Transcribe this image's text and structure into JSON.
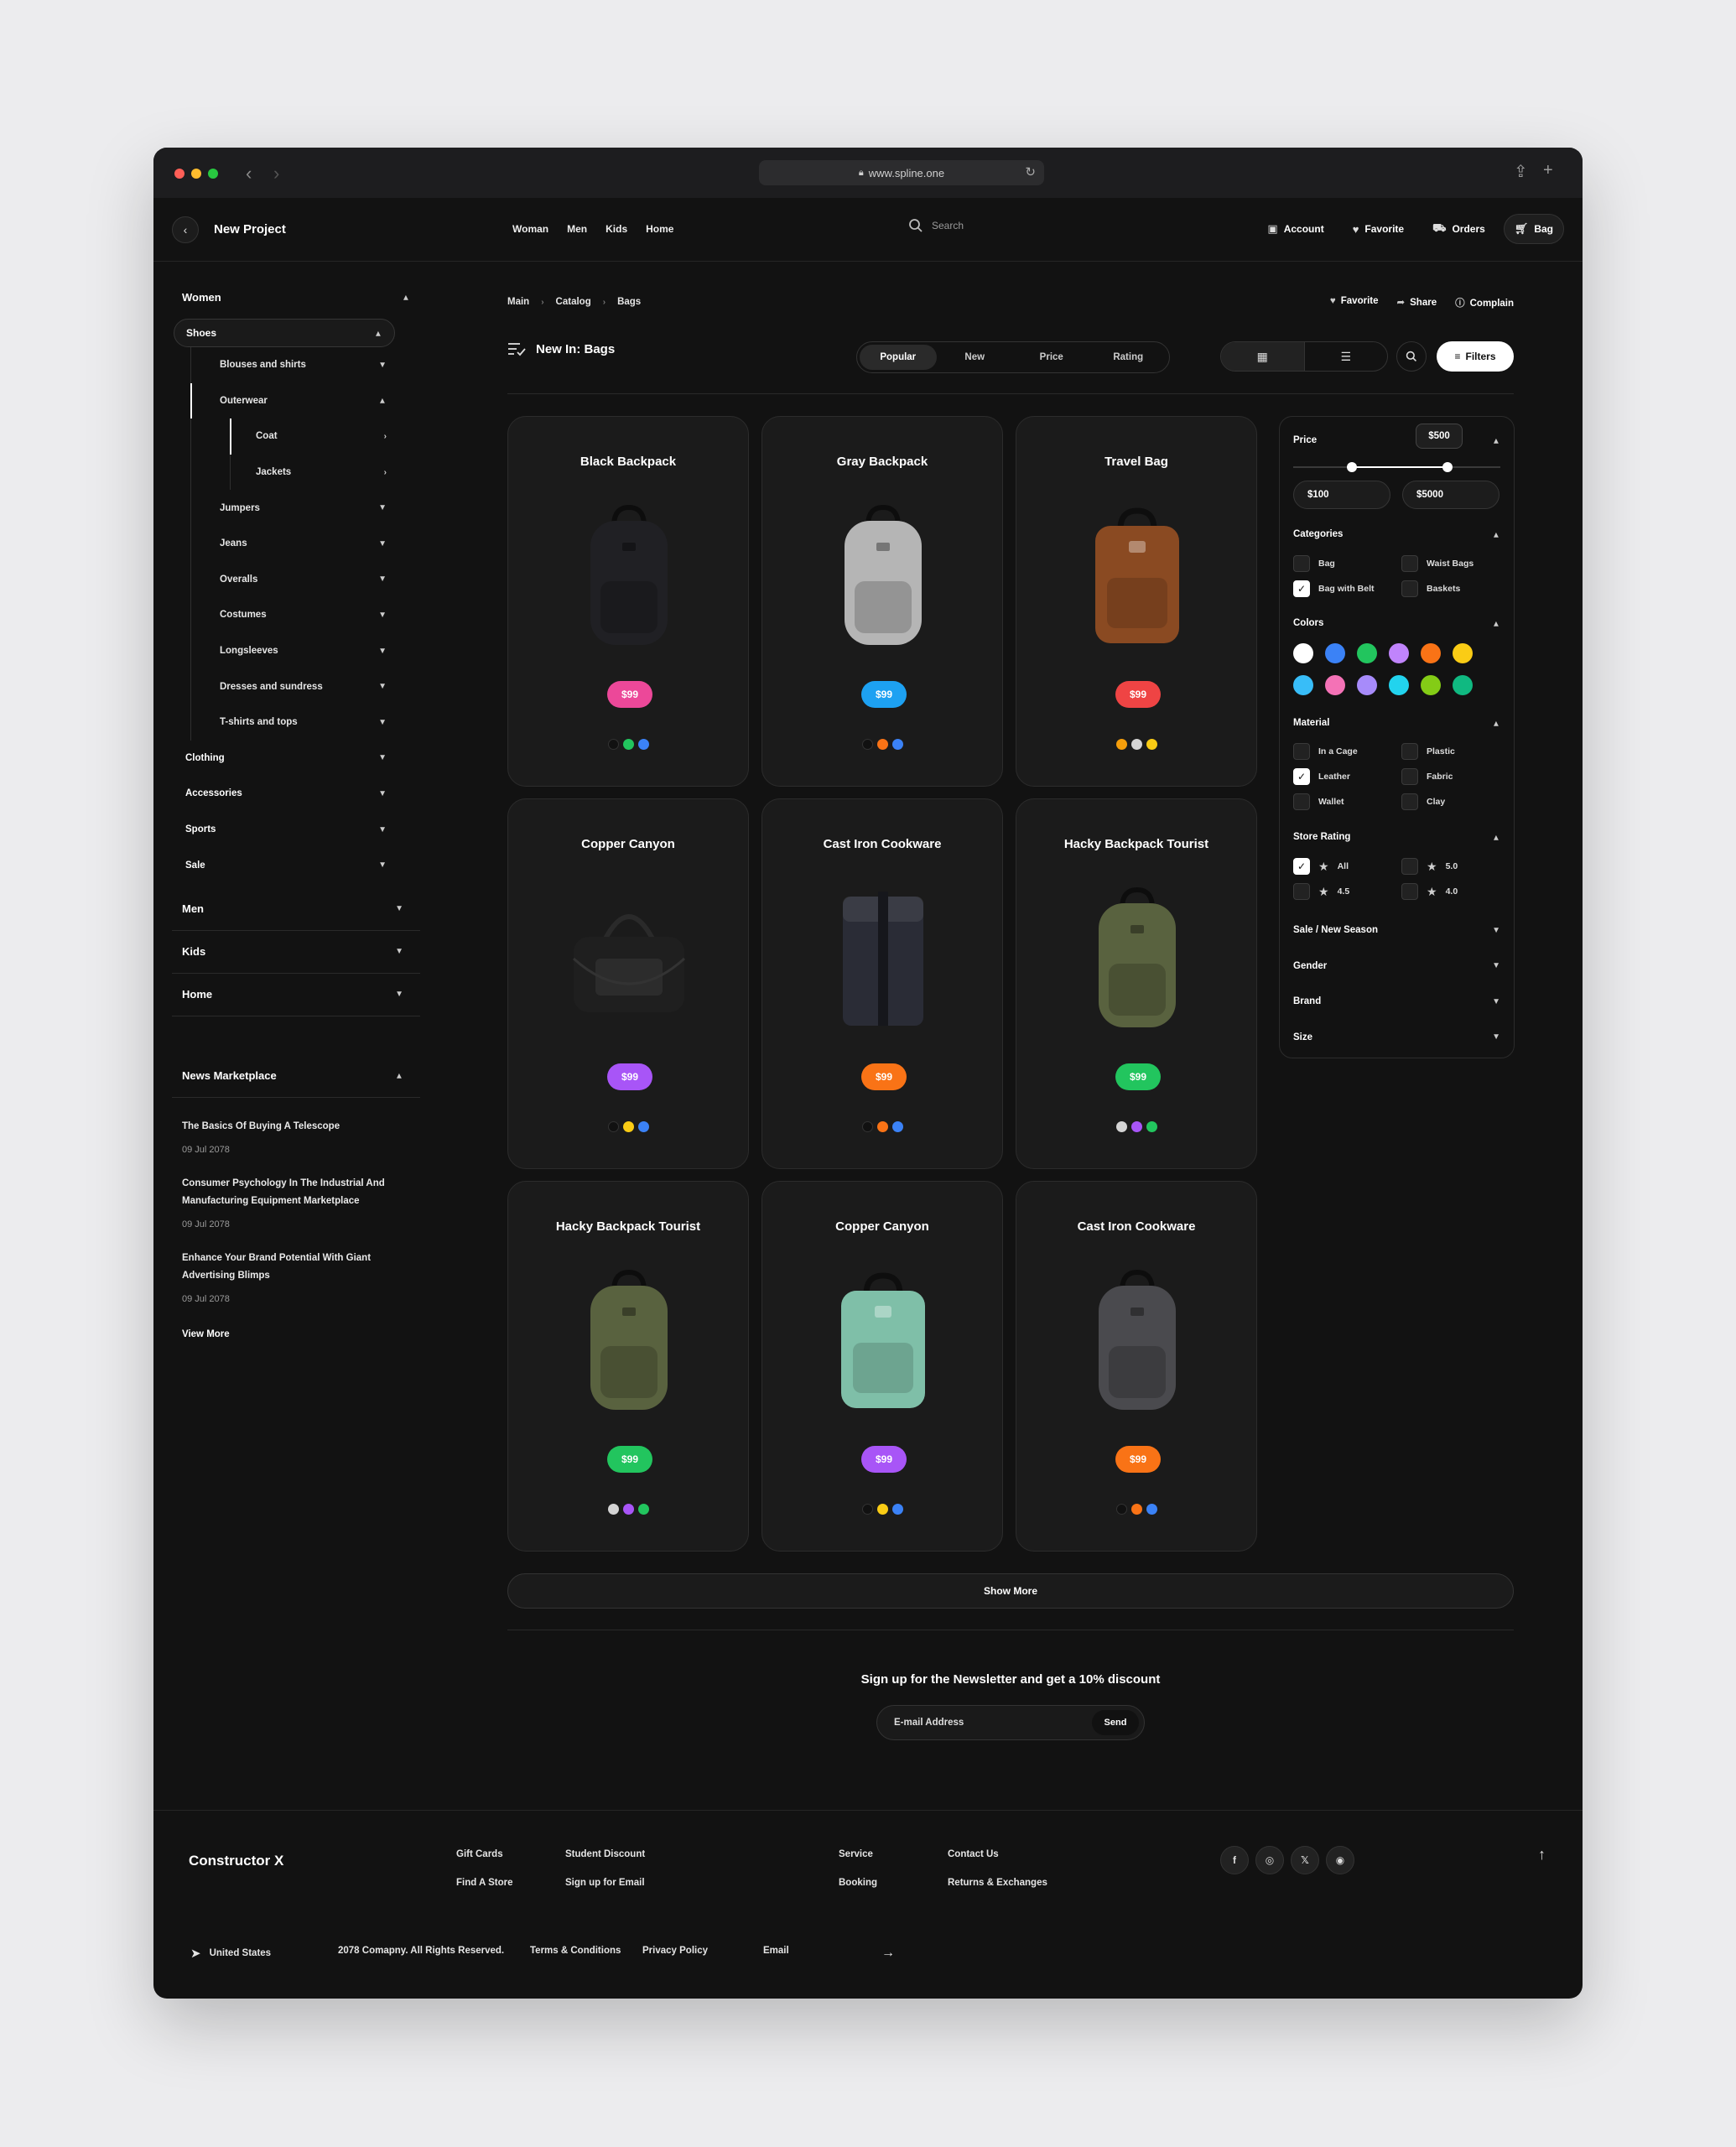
{
  "browser": {
    "url": "www.spline.one"
  },
  "header": {
    "project_title": "New Project",
    "nav": [
      "Woman",
      "Men",
      "Kids",
      "Home"
    ],
    "search_placeholder": "Search",
    "actions": {
      "account": "Account",
      "favorite": "Favorite",
      "orders": "Orders",
      "bag": "Bag"
    }
  },
  "sidebar": {
    "women": "Women",
    "shoes": "Shoes",
    "shoes_items": [
      "Blouses and shirts",
      "Outerwear"
    ],
    "outerwear_items": [
      "Coat",
      "Jackets"
    ],
    "shoes_items_after": [
      "Jumpers",
      "Jeans",
      "Overalls",
      "Costumes",
      "Longsleeves",
      "Dresses and sundress",
      "T-shirts and tops"
    ],
    "women_items": [
      "Clothing",
      "Accessories",
      "Sports",
      "Sale"
    ],
    "main_sections": [
      "Men",
      "Kids",
      "Home"
    ],
    "news": {
      "title": "News Marketplace",
      "items": [
        {
          "title": "The Basics Of Buying A Telescope",
          "date": "09 Jul 2078"
        },
        {
          "title": "Consumer Psychology In The Industrial And Manufacturing Equipment Marketplace",
          "date": "09 Jul 2078"
        },
        {
          "title": "Enhance Your Brand Potential With Giant Advertising Blimps",
          "date": "09 Jul 2078"
        }
      ],
      "view_more": "View More"
    }
  },
  "breadcrumb": [
    "Main",
    "Catalog",
    "Bags"
  ],
  "page_actions": {
    "favorite": "Favorite",
    "share": "Share",
    "complain": "Complain"
  },
  "section_title": "New In: Bags",
  "sort_tabs": [
    "Popular",
    "New",
    "Price",
    "Rating"
  ],
  "filters_label": "Filters",
  "products": [
    {
      "name": "Black Backpack",
      "price": "$99",
      "price_color": "#ec4899",
      "bag_color": "#202024",
      "bag_type": "backpack",
      "swatches": [
        "#111111",
        "#22c55e",
        "#3b82f6"
      ]
    },
    {
      "name": "Gray Backpack",
      "price": "$99",
      "price_color": "#1da1f2",
      "bag_color": "#b5b5b5",
      "bag_type": "backpack",
      "swatches": [
        "#111111",
        "#f97316",
        "#3b82f6"
      ]
    },
    {
      "name": "Travel Bag",
      "price": "$99",
      "price_color": "#ef4444",
      "bag_color": "#8a4a22",
      "bag_type": "square",
      "swatches": [
        "#f59e0b",
        "#d4d4d4",
        "#facc15"
      ]
    },
    {
      "name": "Copper Canyon",
      "price": "$99",
      "price_color": "#a855f7",
      "bag_color": "#1f1f1f",
      "bag_type": "duffel",
      "swatches": [
        "#111111",
        "#facc15",
        "#3b82f6"
      ]
    },
    {
      "name": "Cast Iron Cookware",
      "price": "$99",
      "price_color": "#f97316",
      "bag_color": "#2a2c36",
      "bag_type": "rolltop",
      "swatches": [
        "#111111",
        "#f97316",
        "#3b82f6"
      ]
    },
    {
      "name": "Hacky Backpack Tourist",
      "price": "$99",
      "price_color": "#22c55e",
      "bag_color": "#59623f",
      "bag_type": "backpack",
      "swatches": [
        "#d4d4d4",
        "#a855f7",
        "#22c55e"
      ]
    },
    {
      "name": "Hacky Backpack Tourist",
      "price": "$99",
      "price_color": "#22c55e",
      "bag_color": "#59623f",
      "bag_type": "backpack",
      "swatches": [
        "#d4d4d4",
        "#a855f7",
        "#22c55e"
      ]
    },
    {
      "name": "Copper Canyon",
      "price": "$99",
      "price_color": "#a855f7",
      "bag_color": "#7fbfa8",
      "bag_type": "square",
      "swatches": [
        "#111111",
        "#facc15",
        "#3b82f6"
      ]
    },
    {
      "name": "Cast Iron Cookware",
      "price": "$99",
      "price_color": "#f97316",
      "bag_color": "#4a4a4e",
      "bag_type": "backpack",
      "swatches": [
        "#111111",
        "#f97316",
        "#3b82f6"
      ]
    }
  ],
  "filters": {
    "price": {
      "label": "Price",
      "tag": "$500",
      "min": "$100",
      "max": "$5000",
      "range_fraction": [
        0.28,
        0.74
      ]
    },
    "categories": {
      "label": "Categories",
      "items": [
        {
          "label": "Bag",
          "checked": false
        },
        {
          "label": "Waist Bags",
          "checked": false
        },
        {
          "label": "Bag with Belt",
          "checked": true
        },
        {
          "label": "Baskets",
          "checked": false
        }
      ]
    },
    "colors": {
      "label": "Colors",
      "items": [
        "#ffffff",
        "#3b82f6",
        "#22c55e",
        "#c084fc",
        "#f97316",
        "#facc15",
        "#38bdf8",
        "#f472b6",
        "#a78bfa",
        "#22d3ee",
        "#84cc16",
        "#10b981"
      ]
    },
    "material": {
      "label": "Material",
      "items": [
        {
          "label": "In a Cage",
          "checked": false
        },
        {
          "label": "Plastic",
          "checked": false
        },
        {
          "label": "Leather",
          "checked": true
        },
        {
          "label": "Fabric",
          "checked": false
        },
        {
          "label": "Wallet",
          "checked": false
        },
        {
          "label": "Clay",
          "checked": false
        }
      ]
    },
    "rating": {
      "label": "Store Rating",
      "items": [
        {
          "label": "All",
          "checked": true
        },
        {
          "label": "5.0",
          "checked": false
        },
        {
          "label": "4.5",
          "checked": false
        },
        {
          "label": "4.0",
          "checked": false
        }
      ]
    },
    "collapsed": [
      "Sale / New Season",
      "Gender",
      "Brand",
      "Size"
    ]
  },
  "show_more": "Show More",
  "newsletter": {
    "title": "Sign up for the Newsletter and get a 10% discount",
    "placeholder": "E-mail Address",
    "send": "Send"
  },
  "footer": {
    "brand": "Constructor X",
    "links": {
      "gift_cards": "Gift Cards",
      "find_store": "Find A Store",
      "student_discount": "Student Discount",
      "sign_up_email": "Sign up for Email",
      "service": "Service",
      "booking": "Booking",
      "contact_us": "Contact Us",
      "returns": "Returns & Exchanges"
    },
    "socials": [
      "f",
      "◎",
      "𝕏",
      "◉"
    ],
    "country": "United States",
    "copyright": "2078 Comapny. All Rights Reserved.",
    "terms": "Terms & Conditions",
    "privacy": "Privacy Policy",
    "email_label": "Email"
  }
}
